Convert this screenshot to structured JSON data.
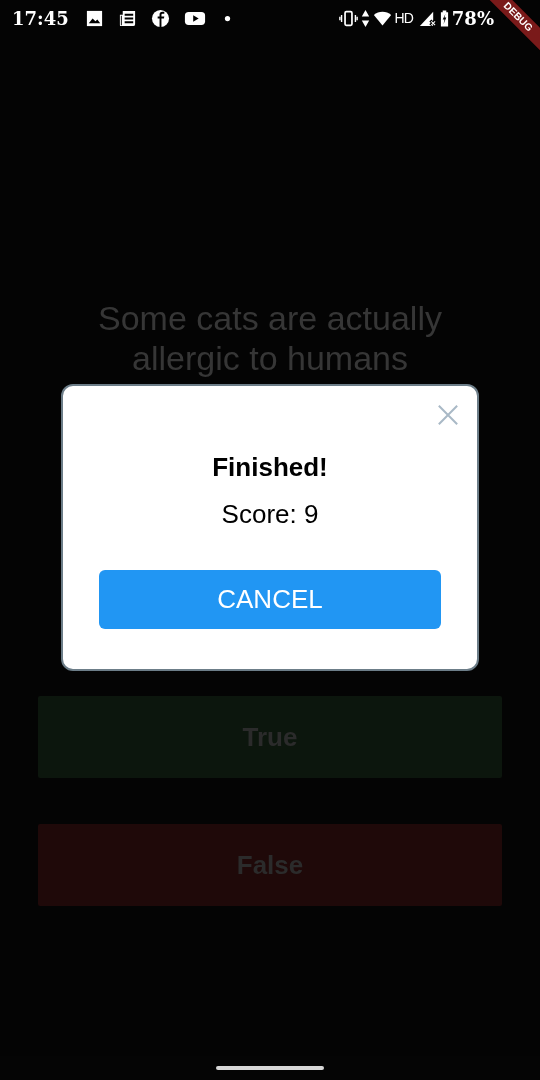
{
  "status_bar": {
    "time": "17:45",
    "network": "HD",
    "battery": "78%"
  },
  "debug_banner": "DEBUG",
  "question": "Some cats are actually allergic to humans",
  "answers": [
    {
      "label": "True",
      "kind": "true"
    },
    {
      "label": "False",
      "kind": "false"
    }
  ],
  "dialog": {
    "title": "Finished!",
    "score": "Score: 9",
    "button": "CANCEL"
  }
}
